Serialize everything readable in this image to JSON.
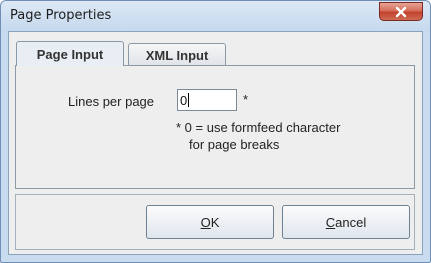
{
  "window": {
    "title": "Page Properties"
  },
  "tabs": [
    {
      "label": "Page Input",
      "active": true
    },
    {
      "label": "XML Input",
      "active": false
    }
  ],
  "page_input": {
    "lines_label": "Lines per page",
    "lines_value": "0",
    "asterisk": "*",
    "note_line1": "* 0 = use formfeed character",
    "note_line2": "for page breaks"
  },
  "buttons": {
    "ok_mnemonic": "O",
    "ok_rest": "K",
    "cancel_mnemonic": "C",
    "cancel_rest": "ancel"
  },
  "icons": {
    "close": "close-icon"
  },
  "colors": {
    "close_button": "#c2412c",
    "frame": "#c9dcef",
    "panel": "#eeeeee"
  }
}
